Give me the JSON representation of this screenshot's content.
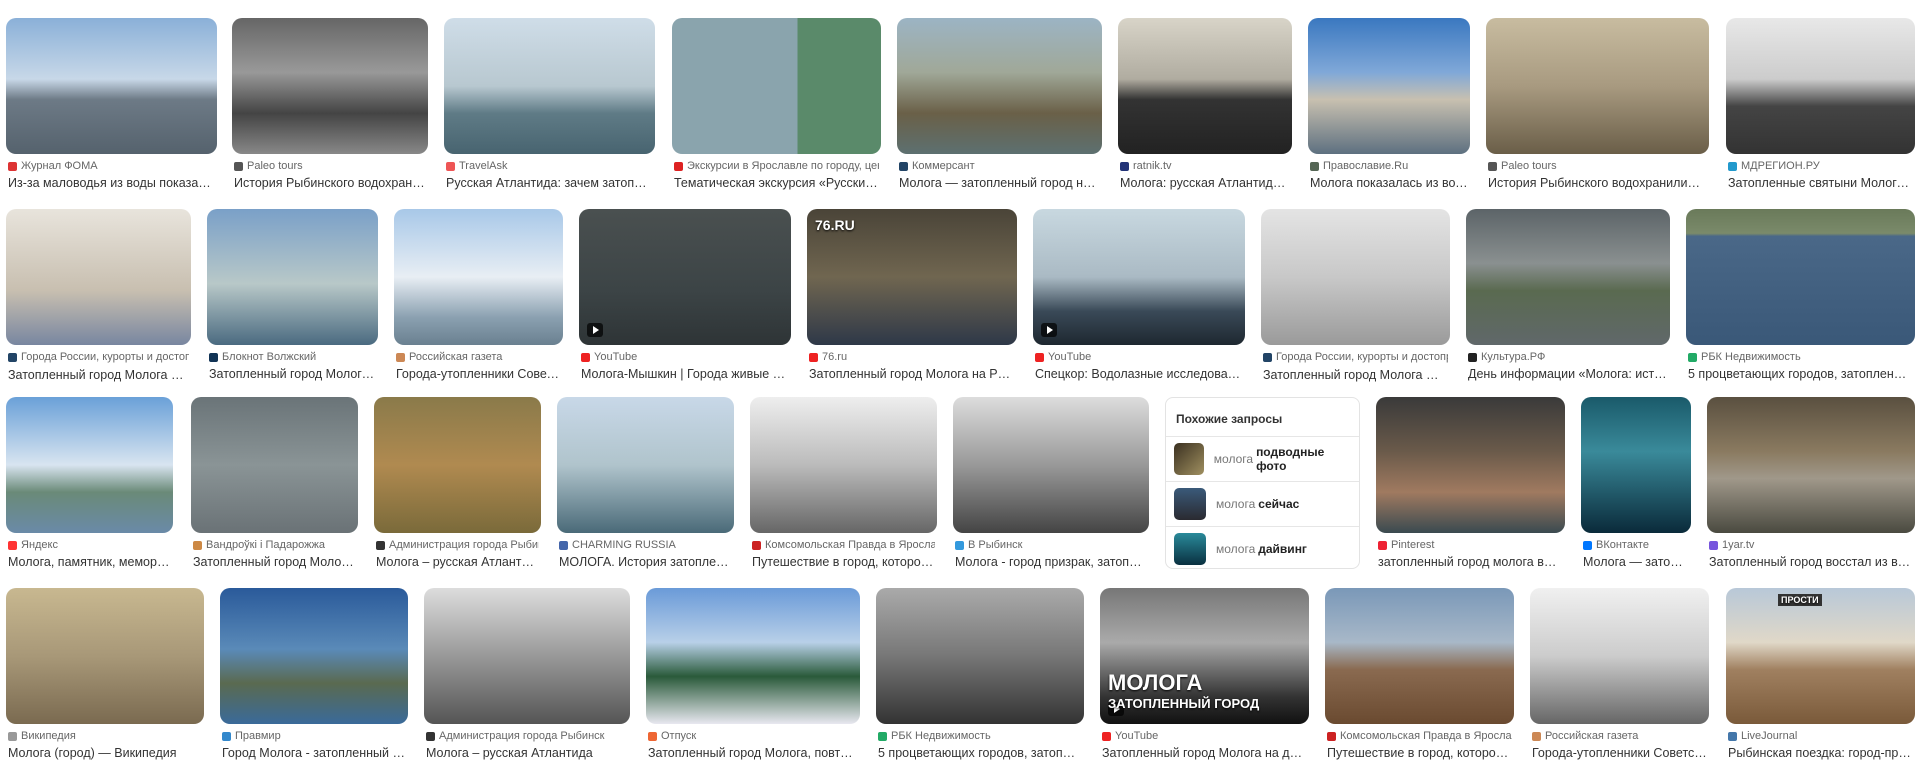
{
  "rows": [
    [
      {
        "source": "Журнал ФОМА",
        "title": "Из-за маловодья из воды показался з...",
        "icon": "#d33"
      },
      {
        "source": "Paleo tours",
        "title": "История Рыбинского водохранили...",
        "icon": "#555"
      },
      {
        "source": "TravelAsk",
        "title": "Русская Атлантида: зачем затопили д...",
        "icon": "#e55"
      },
      {
        "source": "Экскурсии в Ярославле по городу, цены -...",
        "title": "Тематическая экскурсия «Русский эк...",
        "icon": "#d22"
      },
      {
        "source": "Коммерсант",
        "title": "Молога — затопленный город на дне...",
        "icon": "#246"
      },
      {
        "source": "ratnik.tv",
        "title": "Молога: русская Атлантида | R...",
        "icon": "#237"
      },
      {
        "source": "Православие.Ru",
        "title": "Молога показалась из воды...",
        "icon": "#565"
      },
      {
        "source": "Paleo tours",
        "title": "История Рыбинского водохранилища. 3...",
        "icon": "#555"
      },
      {
        "source": "МДРЕГИОН.РУ",
        "title": "Затопленные святыни Мологског...",
        "icon": "#29c"
      }
    ],
    [
      {
        "source": "Города России, курорты и достопри...",
        "title": "Затопленный город Молога ➤ ис...",
        "icon": "#246"
      },
      {
        "source": "Блокнот Волжский",
        "title": "Затопленный город Молога п...",
        "icon": "#135"
      },
      {
        "source": "Российская газета",
        "title": "Города-утопленники Советско...",
        "icon": "#c85"
      },
      {
        "source": "YouTube",
        "title": "Молога-Мышкин | Города живые и мё...",
        "icon": "#e22"
      },
      {
        "source": "76.ru",
        "title": "Затопленный город Молога на Рыбин...",
        "icon": "#e22"
      },
      {
        "source": "YouTube",
        "title": "Спецкор: Водолазные исследования ...",
        "icon": "#e22"
      },
      {
        "source": "Города России, курорты и достопри...",
        "title": "Затопленный город Молога ➤ ис...",
        "icon": "#246"
      },
      {
        "source": "Культура.РФ",
        "title": "День информации «Молога: история...",
        "icon": "#222"
      },
      {
        "source": "РБК Недвижимость",
        "title": "5 процветающих городов, затопленных в...",
        "icon": "#2a6"
      }
    ],
    [
      {
        "source": "Яндекс",
        "title": "Молога, памятник, мемориал...",
        "icon": "#f33"
      },
      {
        "source": "Вандроўкі і Падарожжа",
        "title": "Затопленный город Молога. ...",
        "icon": "#c84"
      },
      {
        "source": "Администрация города Рыбинск",
        "title": "Молога – русская Атлантида",
        "icon": "#333"
      },
      {
        "source": "CHARMING RUSSIA",
        "title": "МОЛОГА. История затопленног...",
        "icon": "#46a"
      },
      {
        "source": "Комсомольская Правда в Ярославле",
        "title": "Путешествие в город, которого н...",
        "icon": "#c22"
      },
      {
        "source": "В Рыбинск",
        "title": "Молога - город призрак, затопленн...",
        "icon": "#39d"
      },
      {
        "source": "Pinterest",
        "title": "затопленный город молога вновь...",
        "icon": "#e23"
      },
      {
        "source": "ВКонтакте",
        "title": "Молога — затопл...",
        "icon": "#07f"
      },
      {
        "source": "1yar.tv",
        "title": "Затопленный город восстал из воды:...",
        "icon": "#75d"
      }
    ],
    [
      {
        "source": "Википедия",
        "title": "Молога (город) — Википедия",
        "icon": "#999"
      },
      {
        "source": "Правмир",
        "title": "Город Молога - затопленный горо...",
        "icon": "#38c"
      },
      {
        "source": "Администрация города Рыбинск",
        "title": "Молога – русская Атлантида",
        "icon": "#333"
      },
      {
        "source": "Отпуск",
        "title": "Затопленный город Молога, повторив...",
        "icon": "#e63"
      },
      {
        "source": "РБК Недвижимость",
        "title": "5 процветающих городов, затопленн...",
        "icon": "#2a6"
      },
      {
        "source": "YouTube",
        "title": "Затопленный город Молога на дне Р...",
        "icon": "#e22"
      },
      {
        "source": "Комсомольская Правда в Ярославле",
        "title": "Путешествие в город, которого не...",
        "icon": "#c22"
      },
      {
        "source": "Российская газета",
        "title": "Города-утопленники Советског...",
        "icon": "#c85"
      },
      {
        "source": "LiveJournal",
        "title": "Рыбинская поездка: город-призра...",
        "icon": "#47a"
      }
    ]
  ],
  "overlays": {
    "ru76": "76.RU",
    "mologa1": "МОЛОГА",
    "mologa2": "ЗАТОПЛЕННЫЙ ГОРОД",
    "prosti": "ПРОСТИ"
  },
  "related": {
    "heading": "Похожие запросы",
    "items": [
      {
        "prefix": "молога",
        "bold": "подводные фото"
      },
      {
        "prefix": "молога",
        "bold": "сейчас"
      },
      {
        "prefix": "молога",
        "bold": "дайвинг"
      }
    ]
  }
}
